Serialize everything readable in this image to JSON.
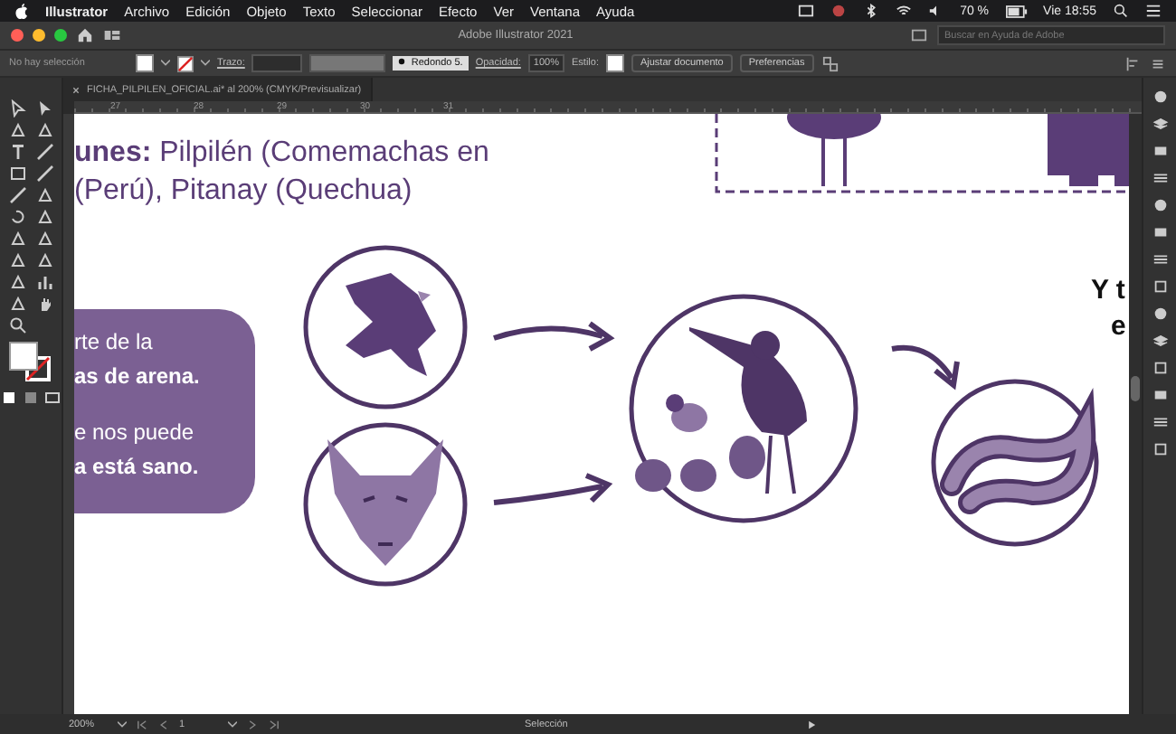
{
  "menu_bar": {
    "app_name": "Illustrator",
    "items": [
      "Archivo",
      "Edición",
      "Objeto",
      "Texto",
      "Seleccionar",
      "Efecto",
      "Ver",
      "Ventana",
      "Ayuda"
    ],
    "battery": "70 %",
    "clock": "Vie 18:55"
  },
  "title_bar": {
    "title": "Adobe Illustrator 2021",
    "search": {
      "placeholder": "Buscar en Ayuda de Adobe"
    }
  },
  "control_bar": {
    "selection": "No hay selección",
    "stroke_label": "Trazo:",
    "brush": "Redondo 5.",
    "opacity_label": "Opacidad:",
    "opacity": "100%",
    "style_label": "Estilo:",
    "buttons": [
      "Ajustar documento",
      "Preferencias"
    ]
  },
  "document": {
    "tab": "FICHA_PILPILEN_OFICIAL.ai* al 200% (CMYK/Previsualizar)",
    "ruler_labels": [
      "27",
      "28",
      "29",
      "30",
      "31"
    ],
    "heading_lines": [
      "**unes:** Pilpilén (Comemachas en",
      "(Perú), Pitanay (Quechua)"
    ],
    "card_lines": [
      {
        "text": "rte de la",
        "bold": false
      },
      {
        "text": "as de arena.",
        "bold": true
      },
      {
        "text": "e nos puede",
        "bold": false
      },
      {
        "text": "a está sano.",
        "bold": true
      }
    ],
    "side_lines": [
      "Y t",
      "e"
    ]
  },
  "status_bar": {
    "zoom": "200%",
    "artboard": "1",
    "tool": "Selección"
  }
}
